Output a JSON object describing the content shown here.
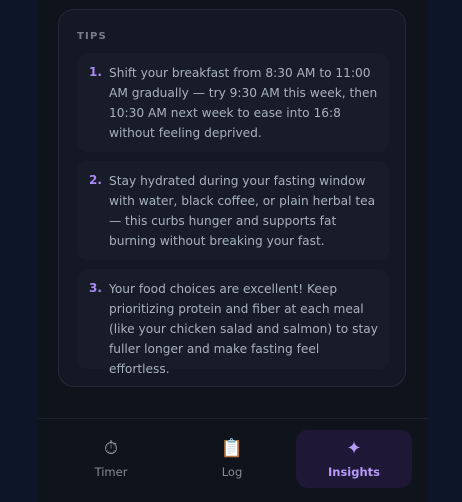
{
  "tips": {
    "heading": "TIPS",
    "items": [
      {
        "number": "1.",
        "text": "Shift your breakfast from 8:30 AM to 11:00 AM gradually — try 9:30 AM this week, then 10:30 AM next week to ease into 16:8 without feeling deprived."
      },
      {
        "number": "2.",
        "text": "Stay hydrated during your fasting window with water, black coffee, or plain herbal tea — this curbs hunger and supports fat burning without breaking your fast."
      },
      {
        "number": "3.",
        "text": "Your food choices are excellent! Keep prioritizing protein and fiber at each meal (like your chicken salad and salmon) to stay fuller longer and make fasting feel effortless."
      }
    ]
  },
  "tab_bar": {
    "active": "Insights",
    "tabs": [
      {
        "label": "Timer",
        "icon": "stopwatch-icon",
        "glyph": "⏱"
      },
      {
        "label": "Log",
        "icon": "clipboard-icon",
        "glyph": "📋"
      },
      {
        "label": "Insights",
        "icon": "sparkle-icon",
        "glyph": "✦"
      }
    ]
  },
  "colors": {
    "accent": "#b79af8",
    "background": "#0f131c",
    "card": "#131824",
    "active_tab_bg": "#1e1836"
  }
}
